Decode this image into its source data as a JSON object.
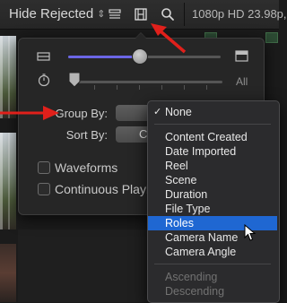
{
  "toolbar": {
    "filter_label": "Hide Rejected",
    "filter_chevrons": "⌃⌄",
    "format_label": "1080p HD 23.98p,",
    "icons": [
      "list-view-icon",
      "filmstrip-icon",
      "search-icon"
    ]
  },
  "popover": {
    "clip_height_icon": "clip-height-icon",
    "clip_height_large_icon": "clip-height-large-icon",
    "duration_icon": "stopwatch-icon",
    "duration_all_label": "All",
    "group_by_label": "Group By:",
    "sort_by_label": "Sort By:",
    "sort_by_value": "C",
    "waveforms_label": "Waveforms",
    "continuous_playback_label": "Continuous Playb"
  },
  "menu": {
    "selected": "None",
    "items_top": [
      "None"
    ],
    "items_main": [
      "Content Created",
      "Date Imported",
      "Reel",
      "Scene",
      "Duration",
      "File Type",
      "Roles",
      "Camera Name",
      "Camera Angle"
    ],
    "highlighted": "Roles",
    "items_order": [
      "Ascending",
      "Descending"
    ]
  },
  "colors": {
    "accent_slider": "#6b66e6",
    "menu_highlight": "#1f67d2",
    "annotation_arrow": "#e0201b"
  }
}
